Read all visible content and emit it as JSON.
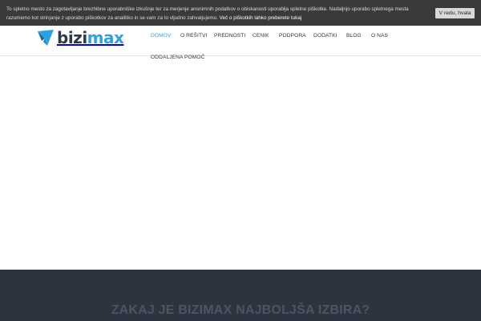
{
  "cookie": {
    "text": "To spletno mesto za zagotavljanje brezhibne uporabniške izkušnje ter za merjenje anonimnih podatkov o obiskanosti uporablja spletne piškotke. Nadaljnjo uporabo spletnega mesta razumemo kot strinjanje z uporabo piškotkov za analitiko in se vam za to vljudno zahvaljujemo.",
    "link_label": "Več o piškotkih lahko preberete tukaj",
    "accept_label": "V redu, hvala"
  },
  "brand": {
    "logo_part1": "bizi",
    "logo_part2": "max",
    "accent_color": "#2aa2e6",
    "dark_color": "#2e3a46"
  },
  "nav": {
    "items": [
      {
        "label": "DOMOV",
        "active": true
      },
      {
        "label": "O REŠITVI",
        "active": false
      },
      {
        "label": "PREDNOSTI",
        "active": false
      },
      {
        "label": "CENIK",
        "active": false
      },
      {
        "label": "PODPORA",
        "active": false
      },
      {
        "label": "DODATKI",
        "active": false
      },
      {
        "label": "BLOG",
        "active": false
      },
      {
        "label": "O NAS",
        "active": false
      },
      {
        "label": "ODDALJENA POMOČ",
        "active": false
      }
    ]
  },
  "section": {
    "title": "ZAKAJ JE BIZIMAX NAJBOLJŠA IZBIRA?"
  }
}
